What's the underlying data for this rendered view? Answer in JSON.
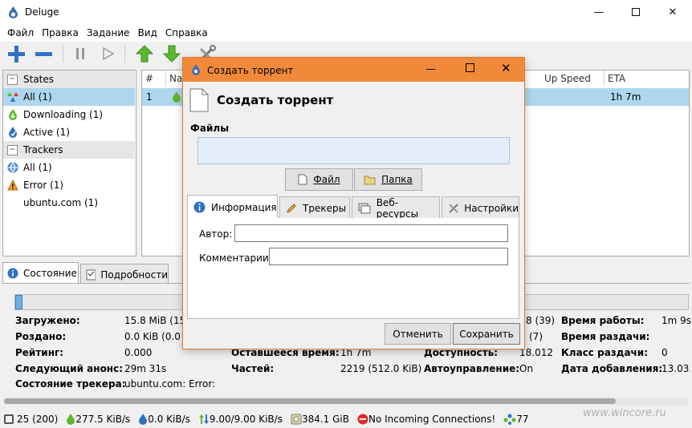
{
  "window": {
    "title": "Deluge"
  },
  "menu": [
    "Файл",
    "Правка",
    "Задание",
    "Вид",
    "Справка"
  ],
  "sidebar": {
    "states_label": "States",
    "states": [
      "All (1)",
      "Downloading (1)",
      "Active (1)"
    ],
    "trackers_label": "Trackers",
    "trackers": [
      "All (1)",
      "Error (1)",
      "ubuntu.com (1)"
    ]
  },
  "torrent_table": {
    "columns": [
      "#",
      "Na",
      "Up Speed",
      "ETA"
    ],
    "row": {
      "num": "1",
      "eta": "1h 7m"
    }
  },
  "bottom_tabs": [
    "Состояние",
    "Подробности"
  ],
  "details": {
    "col1": [
      {
        "label": "Загружено:",
        "value": "15.8 MiB (15."
      },
      {
        "label": "Роздано:",
        "value": "0.0 KiB (0.0 K"
      },
      {
        "label": "Рейтинг:",
        "value": "0.000"
      },
      {
        "label": "Следующий анонс:",
        "value": "29m 31s"
      },
      {
        "label": "Состояние трекера:",
        "value": "ubuntu.com: Error:"
      }
    ],
    "col2": [
      {
        "label": "Оставшееся время:",
        "value": "1h 7m"
      },
      {
        "label": "Частей:",
        "value": "2219 (512.0 KiB)"
      }
    ],
    "col3": [
      {
        "label": "",
        "value": "8 (39)"
      },
      {
        "label": "",
        "value": "(7)"
      },
      {
        "label": "Доступность:",
        "value": "18.012"
      },
      {
        "label": "Автоуправление:",
        "value": "On"
      }
    ],
    "col4": [
      {
        "label": "Время работы:",
        "value": "1m 9s"
      },
      {
        "label": "Время раздачи:",
        "value": ""
      },
      {
        "label": "Класс раздачи:",
        "value": "0"
      },
      {
        "label": "Дата добавления:",
        "value": "13.03."
      }
    ]
  },
  "statusbar": {
    "connections": "25 (200)",
    "down_speed": "277.5 KiB/s",
    "up_speed": "0.0 KiB/s",
    "protocol": "9.00/9.00 KiB/s",
    "disk": "384.1 GiB",
    "incoming": "No Incoming Connections!",
    "dht": "77",
    "watermark": "www.wincore.ru"
  },
  "dialog": {
    "title": "Создать торрент",
    "heading": "Создать торрент",
    "files_label": "Файлы",
    "file_button": "Файл",
    "folder_button": "Папка",
    "tabs": [
      "Информация",
      "Трекеры",
      "Веб-ресурсы",
      "Настройки"
    ],
    "author_label": "Автор:",
    "author_value": "",
    "comments_label": "Комментарии:",
    "comments_value": "",
    "cancel_button": "Отменить",
    "save_button": "Сохранить"
  },
  "colors": {
    "accent": "#f08a3a",
    "selection": "#aed7ef"
  }
}
